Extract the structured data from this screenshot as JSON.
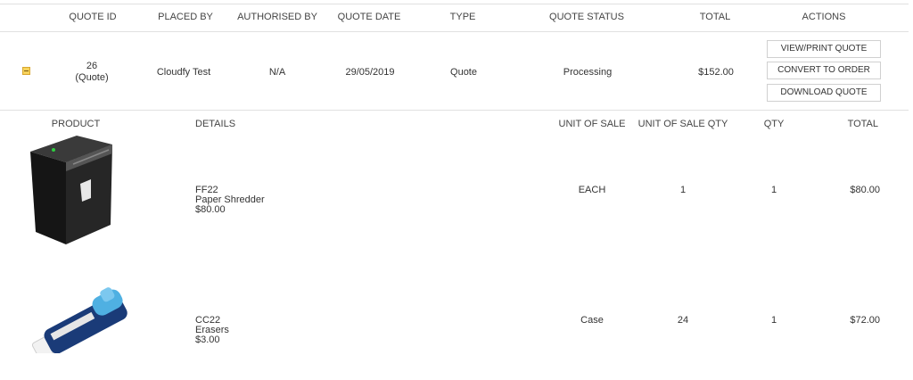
{
  "quote_table": {
    "headers": {
      "quote_id": "QUOTE ID",
      "placed_by": "PLACED BY",
      "authorised_by": "AUTHORISED BY",
      "quote_date": "QUOTE DATE",
      "type": "TYPE",
      "quote_status": "QUOTE STATUS",
      "total": "TOTAL",
      "actions": "ACTIONS"
    },
    "row": {
      "quote_id": "26",
      "quote_id_sub": "(Quote)",
      "placed_by": "Cloudfy Test",
      "authorised_by": "N/A",
      "quote_date": "29/05/2019",
      "type": "Quote",
      "quote_status": "Processing",
      "total": "$152.00"
    },
    "actions": {
      "view_print": "VIEW/PRINT QUOTE",
      "convert": "CONVERT TO ORDER",
      "download": "DOWNLOAD QUOTE"
    }
  },
  "products_table": {
    "headers": {
      "product": "PRODUCT",
      "details": "DETAILS",
      "unit_of_sale": "UNIT OF SALE",
      "unit_of_sale_qty": "UNIT OF SALE QTY",
      "qty": "QTY",
      "total": "TOTAL"
    },
    "items": [
      {
        "code": "FF22",
        "name": "Paper Shredder",
        "price": "$80.00",
        "unit_of_sale": "EACH",
        "unit_of_sale_qty": "1",
        "qty": "1",
        "total": "$80.00"
      },
      {
        "code": "CC22",
        "name": "Erasers",
        "price": "$3.00",
        "unit_of_sale": "Case",
        "unit_of_sale_qty": "24",
        "qty": "1",
        "total": "$72.00"
      }
    ]
  },
  "icons": {
    "toggle": "collapse-toggle-icon"
  }
}
